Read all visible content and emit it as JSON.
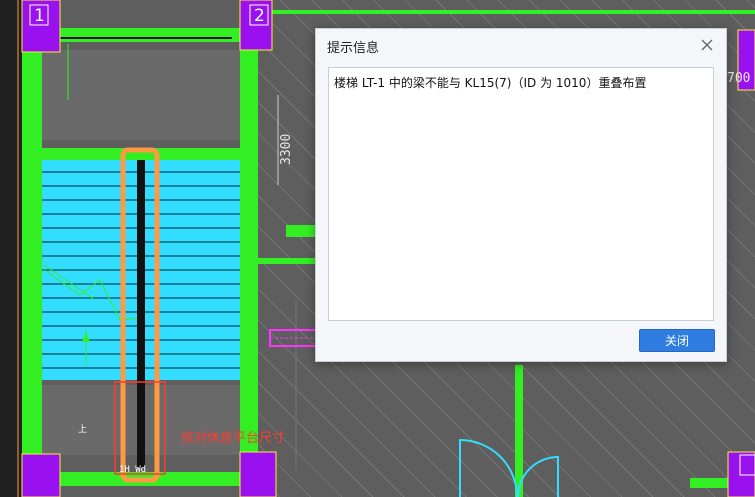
{
  "drawing": {
    "axis_labels": [
      "1",
      "2"
    ],
    "dimension_left": "3300",
    "dimension_right_partial": "700",
    "annotation_note": "核对休息平台尺寸",
    "stair_label": "1H Wd",
    "arrow_label": "上",
    "colors": {
      "background": "#5e5e5e",
      "beam_green": "#33ee22",
      "stair_cyan": "#33ddff",
      "column_purple": "#9911ee",
      "highlight_orange": "#ff9944",
      "note_red": "#ff3b30",
      "magenta": "#ff33ff"
    }
  },
  "dialog": {
    "title": "提示信息",
    "message": "楼梯 LT-1 中的梁不能与 KL15(7)（ID 为 1010）重叠布置",
    "close_button": "关闭",
    "close_icon": "close-icon",
    "accent": "#2f7de1"
  }
}
